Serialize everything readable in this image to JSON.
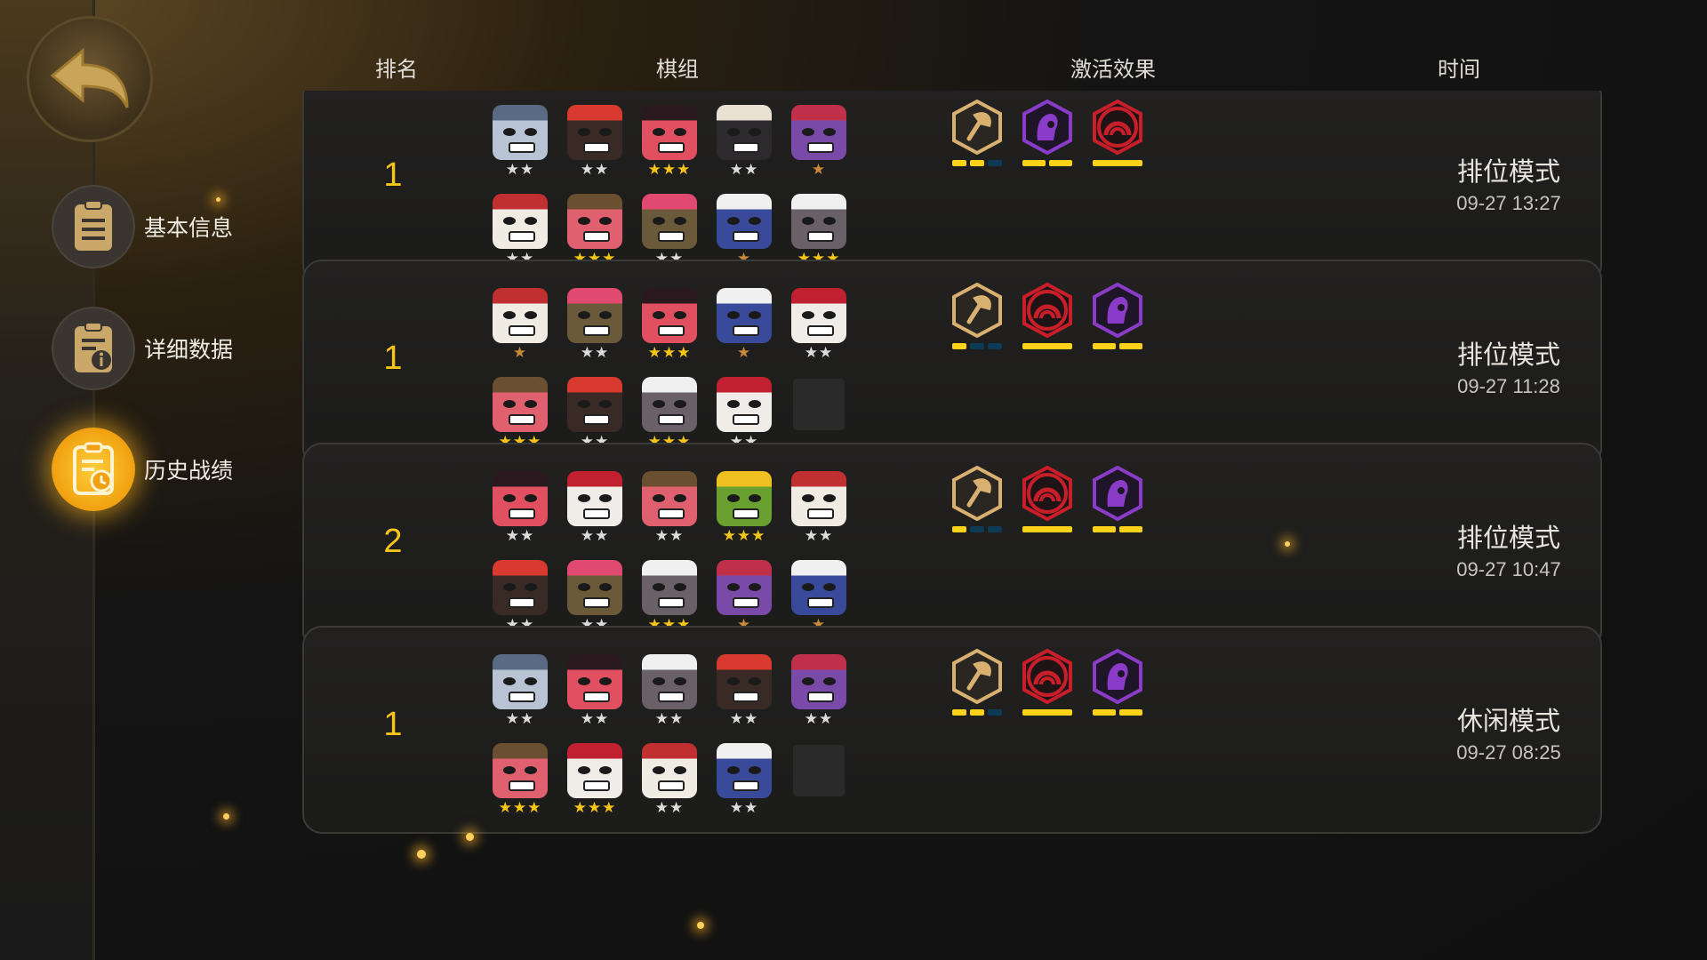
{
  "nav": {
    "back_label": "",
    "items": [
      {
        "label": "基本信息",
        "active": false,
        "icon": "notes-icon"
      },
      {
        "label": "详细数据",
        "active": false,
        "icon": "detail-info-icon"
      },
      {
        "label": "历史战绩",
        "active": true,
        "icon": "history-clock-icon"
      }
    ]
  },
  "header": {
    "rank": "排名",
    "lineup": "棋组",
    "traits": "激活效果",
    "time": "时间"
  },
  "matches": [
    {
      "rank": "1",
      "mode": "排位模式",
      "time": "09-27 13:27",
      "units": [
        {
          "hero": "knight",
          "stars": 2
        },
        {
          "hero": "red-hat",
          "stars": 2
        },
        {
          "hero": "red-demon",
          "stars": 3
        },
        {
          "hero": "dark-hood",
          "stars": 2
        },
        {
          "hero": "purple-box",
          "stars": 1
        },
        {
          "hero": "skull",
          "stars": 2
        },
        {
          "hero": "masked-red",
          "stars": 3
        },
        {
          "hero": "horned-green",
          "stars": 2
        },
        {
          "hero": "blue-hood",
          "stars": 1
        },
        {
          "hero": "gray-hood",
          "stars": 3
        }
      ],
      "traits": [
        {
          "icon": "axe-icon",
          "color": "#d8b070",
          "bars": [
            1,
            1,
            0
          ]
        },
        {
          "icon": "purple-hood-icon",
          "color": "#8a3cc8",
          "bars": [
            1,
            1
          ]
        },
        {
          "icon": "red-arch-icon",
          "color": "#c81e2a",
          "bars": [
            1
          ]
        }
      ]
    },
    {
      "rank": "1",
      "mode": "排位模式",
      "time": "09-27 11:28",
      "units": [
        {
          "hero": "skull",
          "stars": 1
        },
        {
          "hero": "horned-green",
          "stars": 2
        },
        {
          "hero": "red-demon",
          "stars": 3
        },
        {
          "hero": "blue-hood",
          "stars": 1
        },
        {
          "hero": "white-mask",
          "stars": 2
        },
        {
          "hero": "masked-red",
          "stars": 3
        },
        {
          "hero": "red-hat",
          "stars": 2
        },
        {
          "hero": "gray-hood",
          "stars": 3
        },
        {
          "hero": "white-mask",
          "stars": 2
        },
        {
          "hero": "empty",
          "stars": 0
        }
      ],
      "traits": [
        {
          "icon": "axe-icon",
          "color": "#d8b070",
          "bars": [
            1,
            0,
            0
          ]
        },
        {
          "icon": "red-arch-icon",
          "color": "#c81e2a",
          "bars": [
            1
          ]
        },
        {
          "icon": "purple-hood-icon",
          "color": "#8a3cc8",
          "bars": [
            1,
            1
          ]
        }
      ]
    },
    {
      "rank": "2",
      "mode": "排位模式",
      "time": "09-27 10:47",
      "units": [
        {
          "hero": "red-demon",
          "stars": 2
        },
        {
          "hero": "white-mask",
          "stars": 2
        },
        {
          "hero": "masked-red",
          "stars": 2
        },
        {
          "hero": "frog",
          "stars": 3
        },
        {
          "hero": "skull",
          "stars": 2
        },
        {
          "hero": "red-hat",
          "stars": 2
        },
        {
          "hero": "horned-green",
          "stars": 2
        },
        {
          "hero": "gray-hood",
          "stars": 3
        },
        {
          "hero": "purple-box",
          "stars": 1
        },
        {
          "hero": "blue-hood",
          "stars": 1
        }
      ],
      "traits": [
        {
          "icon": "axe-icon",
          "color": "#d8b070",
          "bars": [
            1,
            0,
            0
          ]
        },
        {
          "icon": "red-arch-icon",
          "color": "#c81e2a",
          "bars": [
            1
          ]
        },
        {
          "icon": "purple-hood-icon",
          "color": "#8a3cc8",
          "bars": [
            1,
            1
          ]
        }
      ]
    },
    {
      "rank": "1",
      "mode": "休闲模式",
      "time": "09-27 08:25",
      "units": [
        {
          "hero": "knight",
          "stars": 2
        },
        {
          "hero": "red-demon",
          "stars": 2
        },
        {
          "hero": "gray-hood",
          "stars": 2
        },
        {
          "hero": "red-hat",
          "stars": 2
        },
        {
          "hero": "purple-box",
          "stars": 2
        },
        {
          "hero": "masked-red",
          "stars": 3
        },
        {
          "hero": "white-mask",
          "stars": 3
        },
        {
          "hero": "skull",
          "stars": 2
        },
        {
          "hero": "blue-hood",
          "stars": 2
        },
        {
          "hero": "empty",
          "stars": 0
        }
      ],
      "traits": [
        {
          "icon": "axe-icon",
          "color": "#d8b070",
          "bars": [
            1,
            1,
            0
          ]
        },
        {
          "icon": "red-arch-icon",
          "color": "#c81e2a",
          "bars": [
            1
          ]
        },
        {
          "icon": "purple-hood-icon",
          "color": "#8a3cc8",
          "bars": [
            1,
            1
          ]
        }
      ]
    }
  ]
}
